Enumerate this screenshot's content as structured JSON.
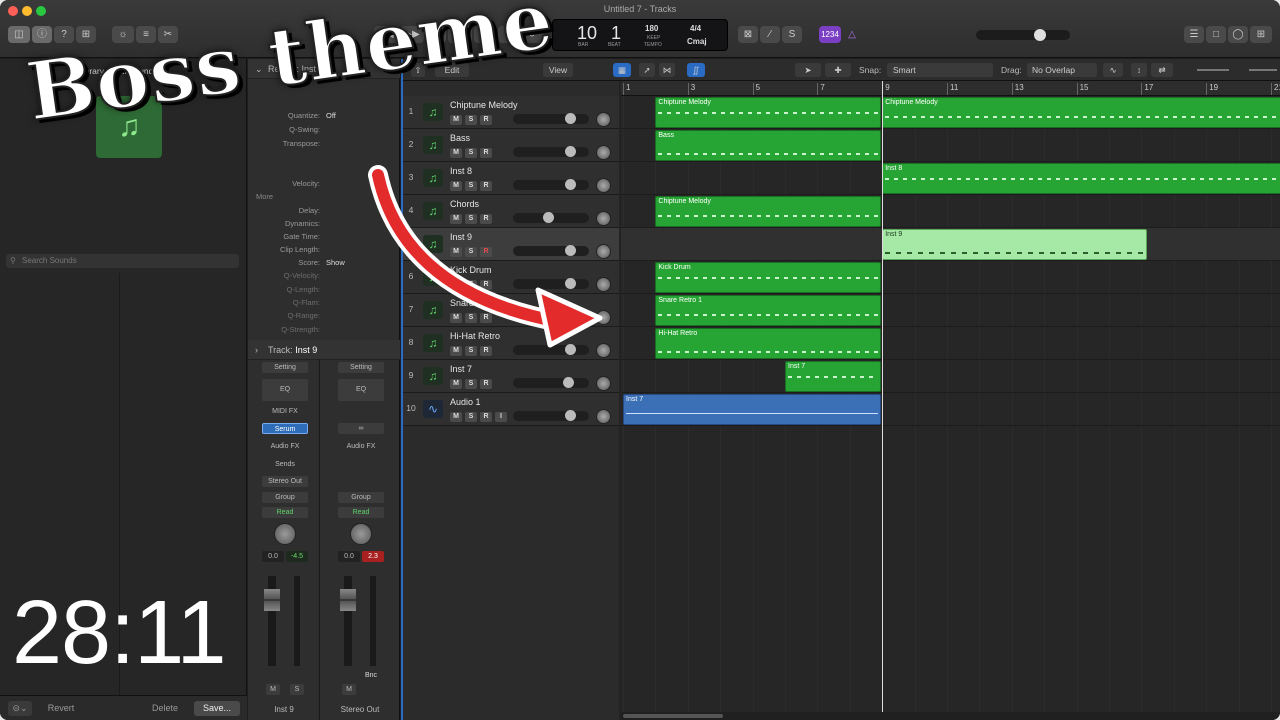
{
  "window": {
    "title": "Untitled 7 - Tracks"
  },
  "transport": {
    "bar": "10",
    "beat": "1",
    "bar_label": "BAR",
    "beat_label": "BEAT",
    "tempo": "180",
    "keep": "KEEP",
    "tempo_label": "TEMPO",
    "signature": "4/4",
    "key": "Cmaj",
    "count_in": "1234"
  },
  "library": {
    "title": "Library",
    "dropdown": "All Sounds",
    "search_placeholder": "Search Sounds",
    "revert": "Revert",
    "delete": "Delete",
    "save": "Save..."
  },
  "inspector": {
    "region_label": "Region:",
    "region_name": "Inst 9",
    "rows": [
      {
        "k": "Quantize:",
        "v": "Off"
      },
      {
        "k": "Q-Swing:",
        "v": ""
      },
      {
        "k": "Transpose:",
        "v": ""
      },
      {
        "k": "Velocity:",
        "v": ""
      }
    ],
    "more_label": "More",
    "more_rows": [
      {
        "k": "Delay:",
        "v": ""
      },
      {
        "k": "Dynamics:",
        "v": ""
      },
      {
        "k": "Gate Time:",
        "v": ""
      },
      {
        "k": "Clip Length:",
        "v": ""
      },
      {
        "k": "Score:",
        "v": "Show"
      },
      {
        "k": "Q-Velocity:",
        "v": ""
      },
      {
        "k": "Q-Length:",
        "v": ""
      },
      {
        "k": "Q-Flam:",
        "v": ""
      },
      {
        "k": "Q-Range:",
        "v": ""
      },
      {
        "k": "Q-Strength:",
        "v": ""
      }
    ],
    "track_label": "Track:",
    "track_name": "Inst 9",
    "strip1": {
      "setting": "Setting",
      "eq": "EQ",
      "midifx": "MIDI FX",
      "plugin": "Serum",
      "audiofx": "Audio FX",
      "sends": "Sends",
      "output": "Stereo Out",
      "group": "Group",
      "automation": "Read",
      "vol": "0.0",
      "peak": "-4.5",
      "m": "M",
      "s": "S",
      "name": "Inst 9"
    },
    "strip2": {
      "setting": "Setting",
      "eq": "EQ",
      "audiofx": "Audio FX",
      "group": "Group",
      "automation": "Read",
      "vol": "0.0",
      "peak": "2.3",
      "m": "M",
      "bnc": "Bnc",
      "name": "Stereo Out"
    }
  },
  "tracks_toolbar": {
    "edit": "Edit",
    "view": "View",
    "snap_label": "Snap:",
    "snap": "Smart",
    "drag_label": "Drag:",
    "drag": "No Overlap"
  },
  "ruler": [
    "1",
    "3",
    "5",
    "7",
    "9",
    "11",
    "13",
    "15",
    "17",
    "19",
    "21"
  ],
  "tracks": [
    {
      "num": "1",
      "name": "Chiptune Melody",
      "type": "inst",
      "rec": false
    },
    {
      "num": "2",
      "name": "Bass",
      "type": "inst",
      "rec": false
    },
    {
      "num": "3",
      "name": "Inst 8",
      "type": "inst",
      "rec": false
    },
    {
      "num": "4",
      "name": "Chords",
      "type": "inst",
      "rec": false
    },
    {
      "num": "5",
      "name": "Inst 9",
      "type": "inst",
      "rec": true
    },
    {
      "num": "6",
      "name": "Kick Drum",
      "type": "inst",
      "rec": false
    },
    {
      "num": "7",
      "name": "Snare Retro 1",
      "type": "inst",
      "rec": false
    },
    {
      "num": "8",
      "name": "Hi-Hat Retro",
      "type": "inst",
      "rec": false
    },
    {
      "num": "9",
      "name": "Inst 7",
      "type": "inst",
      "rec": false
    },
    {
      "num": "10",
      "name": "Audio 1",
      "type": "audio",
      "rec": false
    }
  ],
  "regions": [
    {
      "track": 0,
      "start": 2,
      "end": 9,
      "name": "Chiptune Melody",
      "style": "green"
    },
    {
      "track": 0,
      "start": 9,
      "end": 21.4,
      "name": "Chiptune Melody",
      "style": "green"
    },
    {
      "track": 1,
      "start": 2,
      "end": 9,
      "name": "Bass",
      "style": "green"
    },
    {
      "track": 2,
      "start": 9,
      "end": 21.4,
      "name": "Inst 8",
      "style": "green"
    },
    {
      "track": 3,
      "start": 2,
      "end": 9,
      "name": "Chiptune Melody",
      "style": "green"
    },
    {
      "track": 4,
      "start": 9,
      "end": 17.2,
      "name": "Inst 9",
      "style": "light"
    },
    {
      "track": 5,
      "start": 2,
      "end": 9,
      "name": "Kick Drum",
      "style": "green"
    },
    {
      "track": 6,
      "start": 2,
      "end": 9,
      "name": "Snare Retro 1",
      "style": "green"
    },
    {
      "track": 7,
      "start": 2,
      "end": 9,
      "name": "Hi-Hat Retro",
      "style": "green"
    },
    {
      "track": 8,
      "start": 6,
      "end": 9,
      "name": "Inst 7",
      "style": "green"
    },
    {
      "track": 9,
      "start": 1,
      "end": 9,
      "name": "Inst 7",
      "style": "blue"
    }
  ],
  "playhead_bar": 9,
  "overlay": {
    "caption": "Boss theme",
    "timer": "28:11"
  },
  "colors": {
    "region_green": "#27a534",
    "region_selected": "#a6e9a6",
    "audio_blue": "#3b6fb6",
    "arrow_red": "#e32b2b"
  }
}
